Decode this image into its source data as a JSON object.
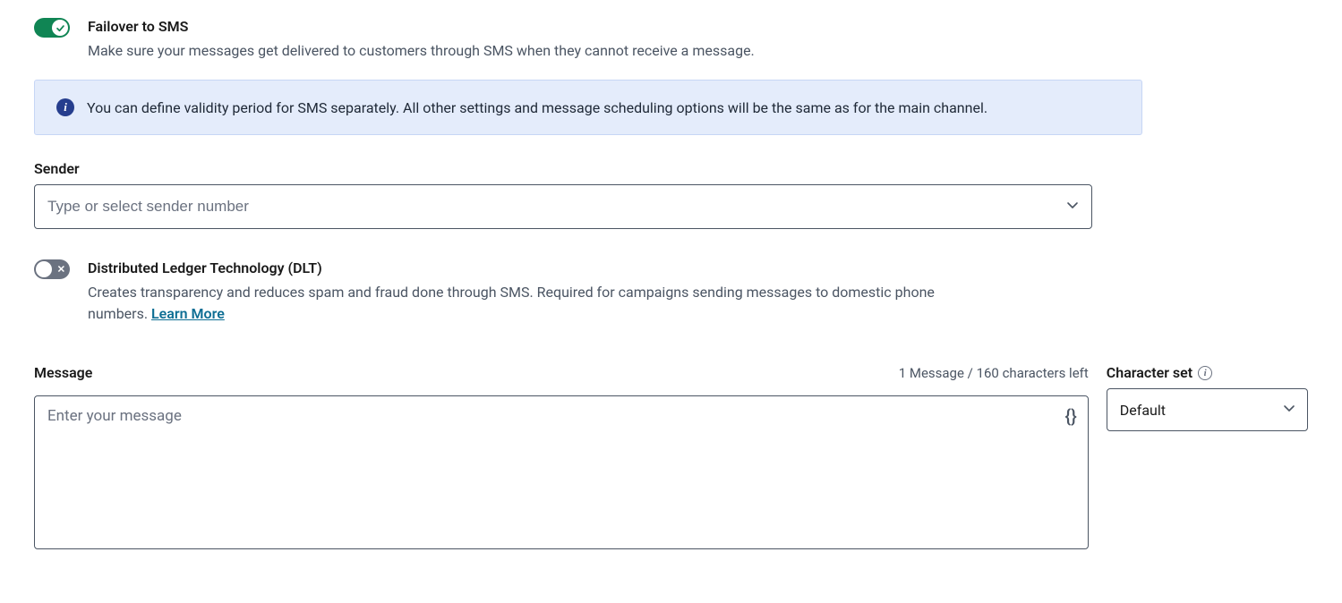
{
  "failover": {
    "title": "Failover to SMS",
    "description": "Make sure your messages get delivered to customers through SMS when they cannot receive a message.",
    "enabled": true
  },
  "infoBanner": {
    "text": "You can define validity period for SMS separately. All other settings and message scheduling options will be the same as for the main channel."
  },
  "sender": {
    "label": "Sender",
    "placeholder": "Type or select sender number",
    "value": ""
  },
  "dlt": {
    "title": "Distributed Ledger Technology (DLT)",
    "description_pre": "Creates transparency and reduces spam and fraud done through SMS. Required for campaigns sending messages to domestic phone numbers. ",
    "learn_more": "Learn More",
    "enabled": false
  },
  "message": {
    "label": "Message",
    "counter": "1 Message / 160 characters left",
    "placeholder": "Enter your message",
    "value": "",
    "placeholder_btn": "{}"
  },
  "charset": {
    "label": "Character set",
    "value": "Default"
  }
}
